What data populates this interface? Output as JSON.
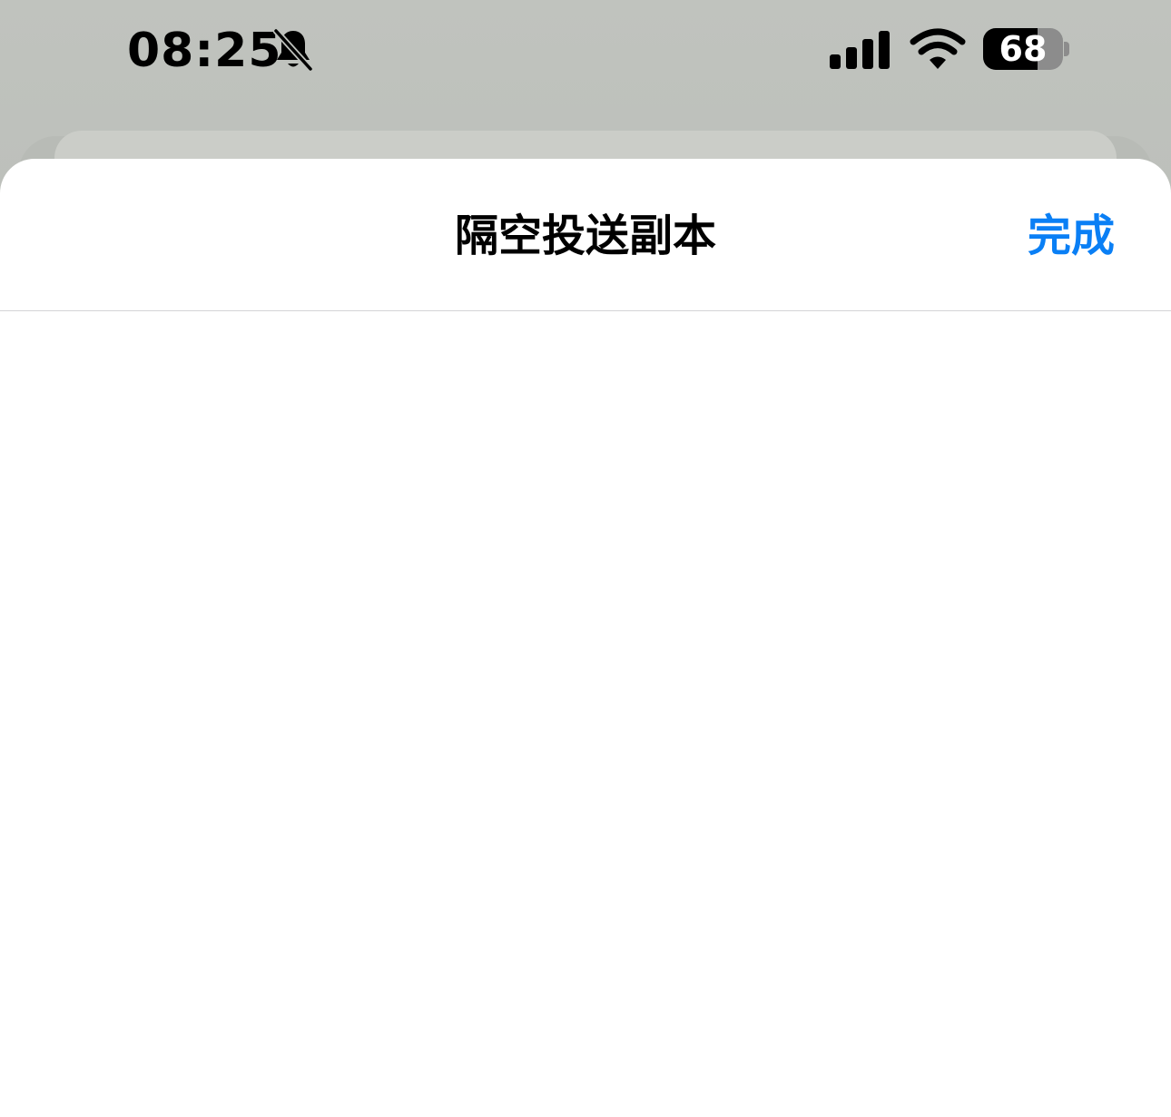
{
  "status_bar": {
    "time": "08:25",
    "battery_level": "68",
    "icons": [
      "bell-slash-icon",
      "cellular-signal-icon",
      "wifi-icon",
      "battery-icon"
    ]
  },
  "sheet": {
    "title": "隔空投送副本",
    "done_label": "完成"
  },
  "colors": {
    "accent": "#0a7ff5",
    "background_dim": "#b4b7b2",
    "sheet": "#ffffff",
    "separator": "#d4d4d6"
  }
}
